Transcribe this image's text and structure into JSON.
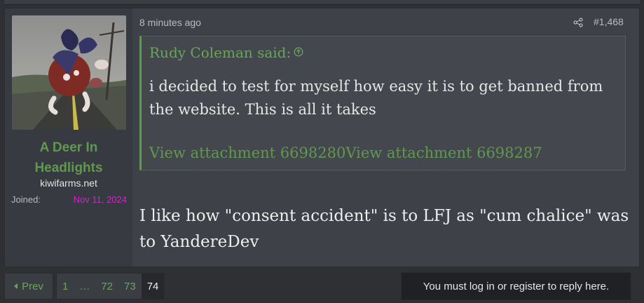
{
  "post": {
    "author": {
      "username": "A Deer In Headlights",
      "title": "kiwifarms.net",
      "joined_label": "Joined:",
      "joined_value": "Nov 11, 2024"
    },
    "time": "8 minutes ago",
    "post_number": "#1,468",
    "quote": {
      "header": "Rudy Coleman said:",
      "body": "i decided to test for myself how easy it is to get banned from the website. This is all it takes",
      "attachments": [
        "View attachment 6698280",
        "View attachment 6698287"
      ]
    },
    "message": "I like how \"consent accident\" is to LFJ as \"cum chalice\" was to YandereDev"
  },
  "pagination": {
    "prev_label": "Prev",
    "pages": [
      "1",
      "…",
      "72",
      "73",
      "74"
    ],
    "current": "74"
  },
  "login_prompt": "You must log in or register to reply here.",
  "colors": {
    "accent_green": "#5f9a4c",
    "joined_magenta": "#c72ac7",
    "background": "#2e3034",
    "post_bg": "#3e4148"
  },
  "icons": [
    "share-icon",
    "arrow-up-circle-icon",
    "chevron-left-icon"
  ]
}
